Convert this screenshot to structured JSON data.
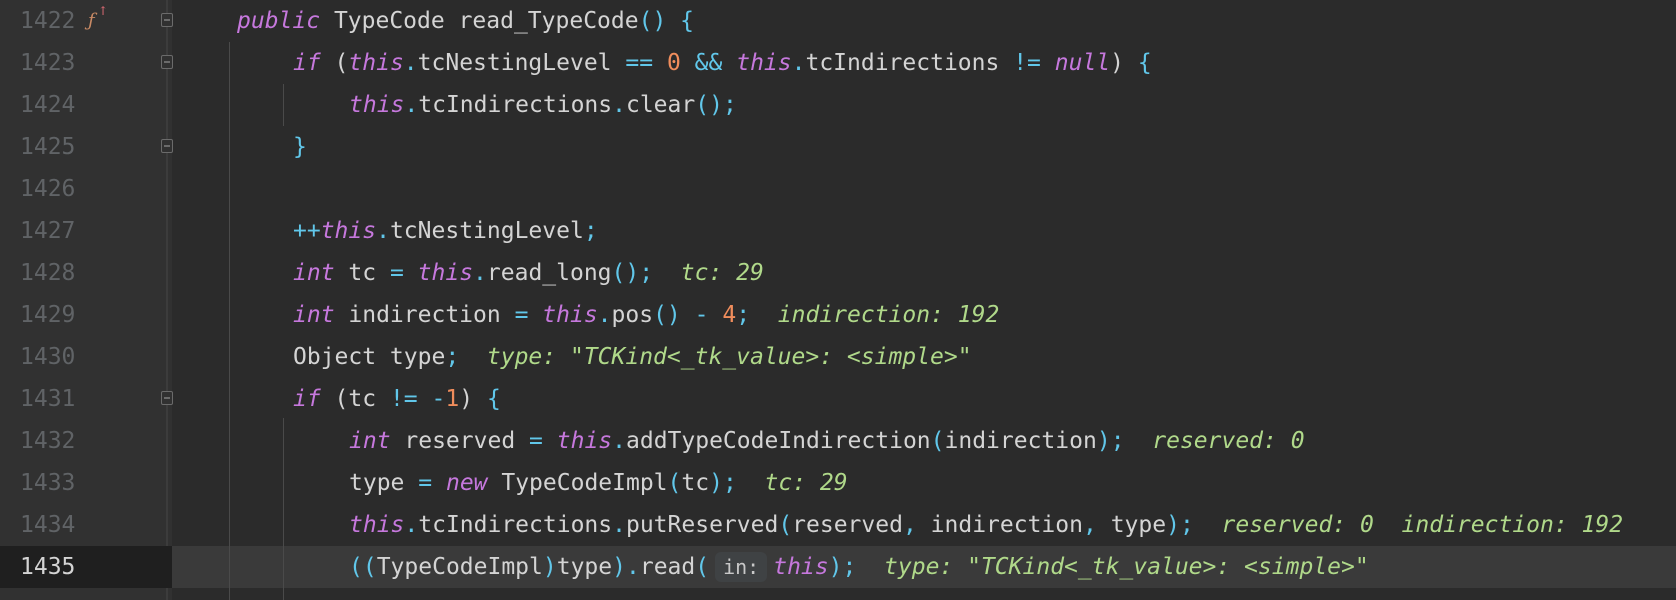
{
  "editor": {
    "lines": [
      {
        "number": "1422",
        "segments": [
          [
            "kw",
            "public"
          ],
          [
            "t",
            " TypeCode read_TypeCode"
          ],
          [
            "punc",
            "()"
          ],
          [
            "t",
            " "
          ],
          [
            "punc",
            "{"
          ]
        ]
      },
      {
        "number": "1423",
        "segments": [
          [
            "kw",
            "if"
          ],
          [
            "t",
            " ("
          ],
          [
            "kw",
            "this"
          ],
          [
            "punc",
            "."
          ],
          [
            "t",
            "tcNestingLevel "
          ],
          [
            "punc",
            "=="
          ],
          [
            "t",
            " "
          ],
          [
            "num",
            "0"
          ],
          [
            "t",
            " "
          ],
          [
            "punc",
            "&&"
          ],
          [
            "t",
            " "
          ],
          [
            "kw",
            "this"
          ],
          [
            "punc",
            "."
          ],
          [
            "t",
            "tcIndirections "
          ],
          [
            "punc",
            "!="
          ],
          [
            "t",
            " "
          ],
          [
            "kw",
            "null"
          ],
          [
            "t",
            ") "
          ],
          [
            "punc",
            "{"
          ]
        ]
      },
      {
        "number": "1424",
        "segments": [
          [
            "kw",
            "this"
          ],
          [
            "punc",
            "."
          ],
          [
            "t",
            "tcIndirections"
          ],
          [
            "punc",
            "."
          ],
          [
            "t",
            "clear"
          ],
          [
            "punc",
            "()"
          ],
          [
            "punc",
            ";"
          ]
        ]
      },
      {
        "number": "1425",
        "segments": [
          [
            "punc",
            "}"
          ]
        ]
      },
      {
        "number": "1426",
        "segments": []
      },
      {
        "number": "1427",
        "segments": [
          [
            "punc",
            "++"
          ],
          [
            "kw",
            "this"
          ],
          [
            "punc",
            "."
          ],
          [
            "t",
            "tcNestingLevel"
          ],
          [
            "punc",
            ";"
          ]
        ]
      },
      {
        "number": "1428",
        "segments": [
          [
            "kw",
            "int"
          ],
          [
            "t",
            " tc "
          ],
          [
            "punc",
            "="
          ],
          [
            "t",
            " "
          ],
          [
            "kw",
            "this"
          ],
          [
            "punc",
            "."
          ],
          [
            "t",
            "read_long"
          ],
          [
            "punc",
            "()"
          ],
          [
            "punc",
            ";"
          ],
          [
            "t",
            "  "
          ],
          [
            "hint",
            "tc: 29"
          ]
        ]
      },
      {
        "number": "1429",
        "segments": [
          [
            "kw",
            "int"
          ],
          [
            "t",
            " indirection "
          ],
          [
            "punc",
            "="
          ],
          [
            "t",
            " "
          ],
          [
            "kw",
            "this"
          ],
          [
            "punc",
            "."
          ],
          [
            "t",
            "pos"
          ],
          [
            "punc",
            "()"
          ],
          [
            "t",
            " "
          ],
          [
            "punc",
            "-"
          ],
          [
            "t",
            " "
          ],
          [
            "num",
            "4"
          ],
          [
            "punc",
            ";"
          ],
          [
            "t",
            "  "
          ],
          [
            "hint",
            "indirection: 192"
          ]
        ]
      },
      {
        "number": "1430",
        "segments": [
          [
            "t",
            "Object type"
          ],
          [
            "punc",
            ";"
          ],
          [
            "t",
            "  "
          ],
          [
            "hint",
            "type: \"TCKind<_tk_value>: <simple>\""
          ]
        ]
      },
      {
        "number": "1431",
        "segments": [
          [
            "kw",
            "if"
          ],
          [
            "t",
            " (tc "
          ],
          [
            "punc",
            "!="
          ],
          [
            "t",
            " "
          ],
          [
            "punc",
            "-"
          ],
          [
            "num",
            "1"
          ],
          [
            "t",
            ") "
          ],
          [
            "punc",
            "{"
          ]
        ]
      },
      {
        "number": "1432",
        "segments": [
          [
            "kw",
            "int"
          ],
          [
            "t",
            " reserved "
          ],
          [
            "punc",
            "="
          ],
          [
            "t",
            " "
          ],
          [
            "kw",
            "this"
          ],
          [
            "punc",
            "."
          ],
          [
            "t",
            "addTypeCodeIndirection"
          ],
          [
            "punc",
            "("
          ],
          [
            "t",
            "indirection"
          ],
          [
            "punc",
            ")"
          ],
          [
            "punc",
            ";"
          ],
          [
            "t",
            "  "
          ],
          [
            "hint",
            "reserved: 0"
          ]
        ]
      },
      {
        "number": "1433",
        "segments": [
          [
            "t",
            "type "
          ],
          [
            "punc",
            "="
          ],
          [
            "t",
            " "
          ],
          [
            "kw",
            "new"
          ],
          [
            "t",
            " TypeCodeImpl"
          ],
          [
            "punc",
            "("
          ],
          [
            "t",
            "tc"
          ],
          [
            "punc",
            ")"
          ],
          [
            "punc",
            ";"
          ],
          [
            "t",
            "  "
          ],
          [
            "hint",
            "tc: 29"
          ]
        ]
      },
      {
        "number": "1434",
        "segments": [
          [
            "kw",
            "this"
          ],
          [
            "punc",
            "."
          ],
          [
            "t",
            "tcIndirections"
          ],
          [
            "punc",
            "."
          ],
          [
            "t",
            "putReserved"
          ],
          [
            "punc",
            "("
          ],
          [
            "t",
            "reserved"
          ],
          [
            "punc",
            ","
          ],
          [
            "t",
            " indirection"
          ],
          [
            "punc",
            ","
          ],
          [
            "t",
            " type"
          ],
          [
            "punc",
            ")"
          ],
          [
            "punc",
            ";"
          ],
          [
            "t",
            "  "
          ],
          [
            "hint",
            "reserved: 0"
          ],
          [
            "t",
            "  "
          ],
          [
            "hint",
            "indirection: 192"
          ]
        ]
      },
      {
        "number": "1435",
        "segments": [
          [
            "punc",
            "(("
          ],
          [
            "t",
            "TypeCodeImpl"
          ],
          [
            "punc",
            ")"
          ],
          [
            "t",
            "type"
          ],
          [
            "punc",
            ")"
          ],
          [
            "punc",
            "."
          ],
          [
            "t",
            "read"
          ],
          [
            "punc",
            "("
          ],
          [
            "inlay",
            "in:"
          ],
          [
            "kw",
            "this"
          ],
          [
            "punc",
            ")"
          ],
          [
            "punc",
            ";"
          ],
          [
            "t",
            "  "
          ],
          [
            "hint",
            "type: \"TCKind<_tk_value>: <simple>\""
          ]
        ]
      }
    ],
    "gutter_icon": {
      "name": "method-override-icon",
      "glyph": "fx"
    }
  },
  "colors": {
    "background": "#2b2b2b",
    "gutter": "#313131",
    "keyword": "#c678dd",
    "number": "#f08d5c",
    "punctuation": "#61c7ea",
    "inline_hint": "#b0d98a",
    "current_line": "#3a3a3a"
  }
}
